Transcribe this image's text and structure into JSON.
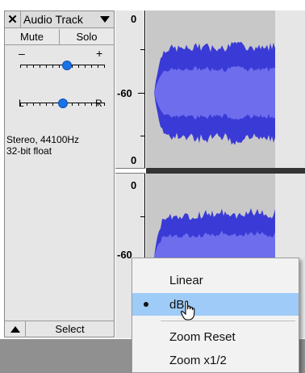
{
  "colors": {
    "waveform": "#3a3ad6",
    "waveform_rms": "#6d6dee",
    "selected_region": "#c8c8c8",
    "panel_bg": "#e6e6e6",
    "slider_thumb": "#1a73e8",
    "menu_highlight": "#9ecbf7"
  },
  "track_panel": {
    "name": "Audio Track",
    "close_icon": "close-icon",
    "menu_icon": "chevron-down-icon",
    "mute_label": "Mute",
    "solo_label": "Solo",
    "gain": {
      "minus_label": "–",
      "plus_label": "+",
      "value": 0.55
    },
    "pan": {
      "left_label": "L",
      "right_label": "R",
      "value": 0.5
    },
    "format_line1": "Stereo, 44100Hz",
    "format_line2": "32-bit float",
    "collapse_icon": "up-triangle-icon",
    "select_label": "Select"
  },
  "ruler": {
    "channel1": {
      "top": "0",
      "mid": "-60",
      "bottom": "0"
    },
    "channel2": {
      "top": "0",
      "mid": "-60"
    }
  },
  "context_menu": {
    "items": [
      {
        "label": "Linear",
        "selected": false
      },
      {
        "label": "dB",
        "selected": true
      },
      {
        "label": "Zoom Reset",
        "selected": false
      },
      {
        "label": "Zoom x1/2",
        "selected": false
      }
    ]
  }
}
